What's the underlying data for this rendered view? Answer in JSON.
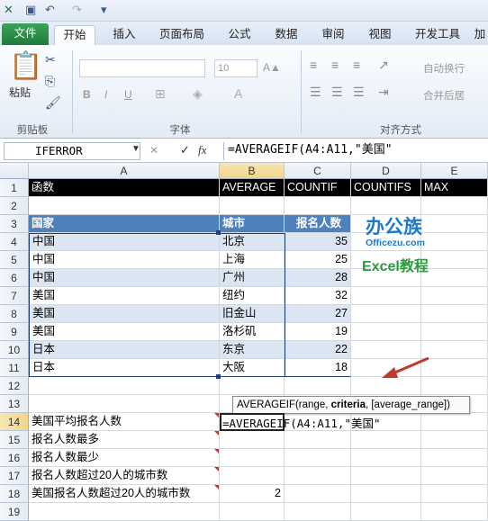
{
  "qat": {
    "icons": [
      "excel-logo-icon",
      "save-icon",
      "undo-icon",
      "redo-icon",
      "customize-icon"
    ]
  },
  "tabs": {
    "file": "文件",
    "items": [
      "开始",
      "插入",
      "页面布局",
      "公式",
      "数据",
      "审阅",
      "视图",
      "开发工具",
      "加"
    ]
  },
  "ribbon": {
    "paste_label": "粘贴",
    "clipboard_label": "剪贴板",
    "font_label": "字体",
    "font_size": "10",
    "align_label": "对齐方式",
    "wrap_label": "自动换行",
    "merge_label": "合并后居",
    "bold": "B",
    "italic": "I",
    "underline": "U"
  },
  "formula_bar": {
    "name_box": "IFERROR",
    "fx": "fx",
    "formula": "=AVERAGEIF(A4:A11,\"美国\""
  },
  "columns": [
    "A",
    "B",
    "C",
    "D",
    "E"
  ],
  "rows": [
    "1",
    "2",
    "3",
    "4",
    "5",
    "6",
    "7",
    "8",
    "9",
    "10",
    "11",
    "12",
    "13",
    "14",
    "15",
    "16",
    "17",
    "18",
    "19"
  ],
  "row1": {
    "a": "函数",
    "b": "AVERAGE",
    "c": "COUNTIF",
    "d": "COUNTIFS",
    "e": "MAX"
  },
  "table_header": {
    "a": "国家",
    "b": "城市",
    "c": "报名人数"
  },
  "table_rows": [
    {
      "a": "中国",
      "b": "北京",
      "c": "35"
    },
    {
      "a": "中国",
      "b": "上海",
      "c": "25"
    },
    {
      "a": "中国",
      "b": "广州",
      "c": "28"
    },
    {
      "a": "美国",
      "b": "纽约",
      "c": "32"
    },
    {
      "a": "美国",
      "b": "旧金山",
      "c": "27"
    },
    {
      "a": "美国",
      "b": "洛杉矶",
      "c": "19"
    },
    {
      "a": "日本",
      "b": "东京",
      "c": "22"
    },
    {
      "a": "日本",
      "b": "大阪",
      "c": "18"
    }
  ],
  "questions": [
    {
      "a": "美国平均报名人数",
      "b": "=AVERAGEIF(A4:A11,\"美国\""
    },
    {
      "a": "报名人数最多",
      "b": ""
    },
    {
      "a": "报名人数最少",
      "b": ""
    },
    {
      "a": "报名人数超过20人的城市数",
      "b": ""
    },
    {
      "a": "美国报名人数超过20人的城市数",
      "b": "2"
    }
  ],
  "tooltip": {
    "prefix": "AVERAGEIF(range, ",
    "bold": "criteria",
    "suffix": ", [average_range])"
  },
  "logo": {
    "line1": "办公族",
    "line2": "Officezu.com",
    "line3": "Excel教程"
  },
  "colors": {
    "header_blue": "#4f81bd",
    "band": "#dce6f2",
    "file_green": "#1f7a3a",
    "arrow_red": "#c0392b"
  }
}
